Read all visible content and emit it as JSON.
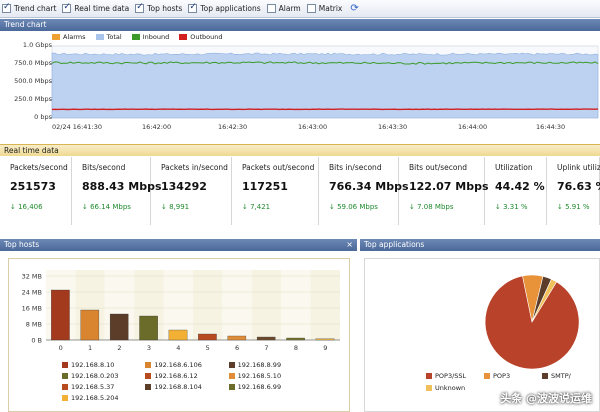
{
  "toolbar": {
    "items": [
      {
        "label": "Trend chart",
        "checked": true
      },
      {
        "label": "Real time data",
        "checked": true
      },
      {
        "label": "Top hosts",
        "checked": true
      },
      {
        "label": "Top applications",
        "checked": true
      },
      {
        "label": "Alarm",
        "checked": false
      },
      {
        "label": "Matrix",
        "checked": false
      }
    ],
    "refresh_icon": "refresh-icon"
  },
  "trend": {
    "title": "Trend chart",
    "legend": [
      {
        "name": "Alarms",
        "color": "#f0a030"
      },
      {
        "name": "Total",
        "color": "#a9c4ea"
      },
      {
        "name": "Inbound",
        "color": "#3b9a2a"
      },
      {
        "name": "Outbound",
        "color": "#d21f1f"
      }
    ],
    "y_ticks": [
      "1.0 Gbps",
      "750.0 Mbps",
      "500.0 Mbps",
      "250.0 Mbps",
      "0 bps"
    ],
    "x_ticks": [
      "02/24 16:41:30",
      "16:42:00",
      "16:42:30",
      "16:43:00",
      "16:43:30",
      "16:44:00",
      "16:44:30"
    ]
  },
  "chart_data": {
    "type": "area",
    "x": [
      "16:41:30",
      "16:42:00",
      "16:42:30",
      "16:43:00",
      "16:43:30",
      "16:44:00",
      "16:44:30"
    ],
    "series": [
      {
        "name": "Total",
        "values": [
          890,
          885,
          890,
          888,
          886,
          889,
          888
        ]
      },
      {
        "name": "Inbound",
        "values": [
          770,
          765,
          770,
          766,
          760,
          768,
          766
        ]
      },
      {
        "name": "Outbound",
        "values": [
          120,
          122,
          121,
          122,
          121,
          122,
          122
        ]
      }
    ],
    "ylim": [
      0,
      1000
    ],
    "ylabel": ""
  },
  "realtime": {
    "title": "Real time data",
    "metrics": [
      {
        "label": "Packets/second",
        "value": "251573",
        "delta": "↓ 16,406"
      },
      {
        "label": "Bits/second",
        "value": "888.43 Mbps",
        "delta": "↓ 66.14 Mbps"
      },
      {
        "label": "Packets in/second",
        "value": "134292",
        "delta": "↓ 8,991"
      },
      {
        "label": "Packets out/second",
        "value": "117251",
        "delta": "↓ 7,421"
      },
      {
        "label": "Bits in/second",
        "value": "766.34 Mbps",
        "delta": "↓ 59.06 Mbps"
      },
      {
        "label": "Bits out/second",
        "value": "122.07 Mbps",
        "delta": "↓ 7.08 Mbps"
      },
      {
        "label": "Utilization",
        "value": "44.42 %",
        "delta": "↓ 3.31 %"
      },
      {
        "label": "Uplink utiliz",
        "value": "76.63 %",
        "delta": "↓ 5.91 %"
      }
    ]
  },
  "hosts": {
    "title": "Top hosts",
    "close": "×",
    "y_ticks": [
      "32 MB",
      "24 MB",
      "16 MB",
      "8 MB",
      "0 B"
    ],
    "bars": [
      {
        "cat": "0",
        "value": 25,
        "color": "#a33a1e"
      },
      {
        "cat": "1",
        "value": 15,
        "color": "#d98530"
      },
      {
        "cat": "2",
        "value": 13,
        "color": "#5b3d2a"
      },
      {
        "cat": "3",
        "value": 12,
        "color": "#6b6b2a"
      },
      {
        "cat": "4",
        "value": 5,
        "color": "#f2b035"
      },
      {
        "cat": "5",
        "value": 3,
        "color": "#b84a20"
      },
      {
        "cat": "6",
        "value": 2,
        "color": "#e08d3a"
      },
      {
        "cat": "7",
        "value": 1.5,
        "color": "#6d4b2c"
      },
      {
        "cat": "8",
        "value": 1,
        "color": "#77772e"
      },
      {
        "cat": "9",
        "value": 0.6,
        "color": "#f3bb45"
      }
    ],
    "legend": [
      {
        "name": "192.168.8.10",
        "color": "#a33a1e"
      },
      {
        "name": "192.168.6.106",
        "color": "#d98530"
      },
      {
        "name": "192.168.8.99",
        "color": "#5b3d2a"
      },
      {
        "name": "192.168.0.203",
        "color": "#6b6b2a"
      },
      {
        "name": "192.168.6.12",
        "color": "#b84a20"
      },
      {
        "name": "192.168.5.10",
        "color": "#e08d3a"
      },
      {
        "name": "192.168.5.37",
        "color": "#b84a20"
      },
      {
        "name": "192.168.8.104",
        "color": "#5b3d2a"
      },
      {
        "name": "192.168.6.99",
        "color": "#6b6b2a"
      },
      {
        "name": "192.168.5.204",
        "color": "#f2b035"
      }
    ]
  },
  "apps": {
    "title": "Top applications",
    "slices": [
      {
        "name": "POP3/SSL",
        "value": 88,
        "color": "#b8432a"
      },
      {
        "name": "POP3",
        "value": 7,
        "color": "#e8923a"
      },
      {
        "name": "SMTP/",
        "value": 3,
        "color": "#5b3d2a"
      },
      {
        "name": "Unknown",
        "value": 2,
        "color": "#f0c05a"
      }
    ],
    "watermark": "头条 @波波说运维"
  }
}
